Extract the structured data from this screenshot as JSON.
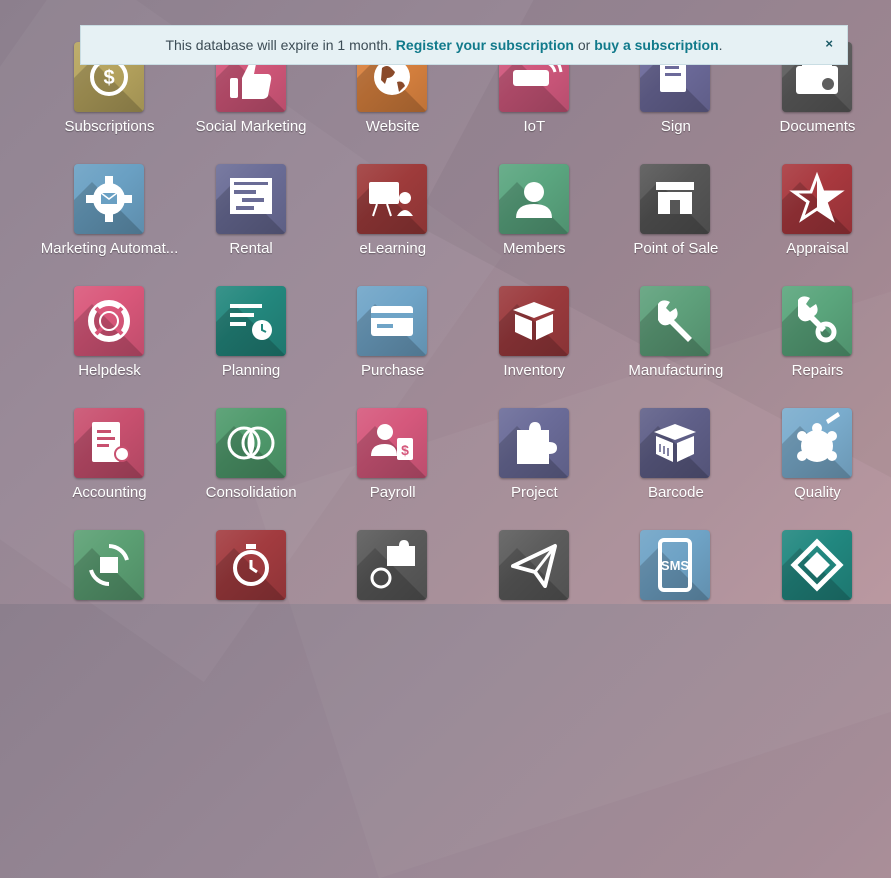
{
  "banner": {
    "text_before": "This database will expire in 1 month.",
    "register_link": "Register your subscription",
    "or_text": "or",
    "buy_link": "buy a subscription",
    "close_label": "×"
  },
  "apps": [
    {
      "label": "Subscriptions",
      "color": "#b6a45e",
      "icon": "subscriptions-icon"
    },
    {
      "label": "Social Marketing",
      "color": "#d2577a",
      "icon": "thumbs-up-icon"
    },
    {
      "label": "Website",
      "color": "#d9823f",
      "icon": "globe-icon"
    },
    {
      "label": "IoT",
      "color": "#d0587d",
      "icon": "iot-device-icon"
    },
    {
      "label": "Sign",
      "color": "#6c6a9a",
      "icon": "sign-document-icon"
    },
    {
      "label": "Documents",
      "color": "#5e5e5e",
      "icon": "document-box-icon"
    },
    {
      "label": "Marketing Automat...",
      "color": "#6aa0c3",
      "icon": "gear-mail-icon"
    },
    {
      "label": "Rental",
      "color": "#6a6c96",
      "icon": "gantt-calendar-icon"
    },
    {
      "label": "eLearning",
      "color": "#9e3b3b",
      "icon": "teacher-board-icon"
    },
    {
      "label": "Members",
      "color": "#5aa57f",
      "icon": "user-icon"
    },
    {
      "label": "Point of Sale",
      "color": "#565656",
      "icon": "store-icon"
    },
    {
      "label": "Appraisal",
      "color": "#a8383e",
      "icon": "star-icon"
    },
    {
      "label": "Helpdesk",
      "color": "#d9577a",
      "icon": "lifebuoy-icon"
    },
    {
      "label": "Planning",
      "color": "#23877d",
      "icon": "planning-clock-icon"
    },
    {
      "label": "Purchase",
      "color": "#6fa4c7",
      "icon": "credit-card-icon"
    },
    {
      "label": "Inventory",
      "color": "#9b3a3d",
      "icon": "box-icon"
    },
    {
      "label": "Manufacturing",
      "color": "#5ea07b",
      "icon": "wrench-icon"
    },
    {
      "label": "Repairs",
      "color": "#5aa57c",
      "icon": "wrench-gear-icon"
    },
    {
      "label": "Accounting",
      "color": "#c8506f",
      "icon": "invoice-gear-icon"
    },
    {
      "label": "Consolidation",
      "color": "#4f9a6c",
      "icon": "venn-circles-icon"
    },
    {
      "label": "Payroll",
      "color": "#d5587c",
      "icon": "payroll-icon"
    },
    {
      "label": "Project",
      "color": "#6a6b98",
      "icon": "puzzle-icon"
    },
    {
      "label": "Barcode",
      "color": "#5f5f88",
      "icon": "barcode-box-icon"
    },
    {
      "label": "Quality",
      "color": "#7aaccd",
      "icon": "quality-badge-icon"
    },
    {
      "label": "",
      "color": "#5b9f73",
      "icon": "box-refresh-icon"
    },
    {
      "label": "",
      "color": "#a23b3f",
      "icon": "stopwatch-icon"
    },
    {
      "label": "",
      "color": "#5a5a5a",
      "icon": "puzzle-timer-icon"
    },
    {
      "label": "",
      "color": "#5c5c5c",
      "icon": "paper-plane-icon"
    },
    {
      "label": "",
      "color": "#6fa3c6",
      "icon": "sms-phone-icon"
    },
    {
      "label": "",
      "color": "#21877f",
      "icon": "ticket-icon"
    }
  ]
}
